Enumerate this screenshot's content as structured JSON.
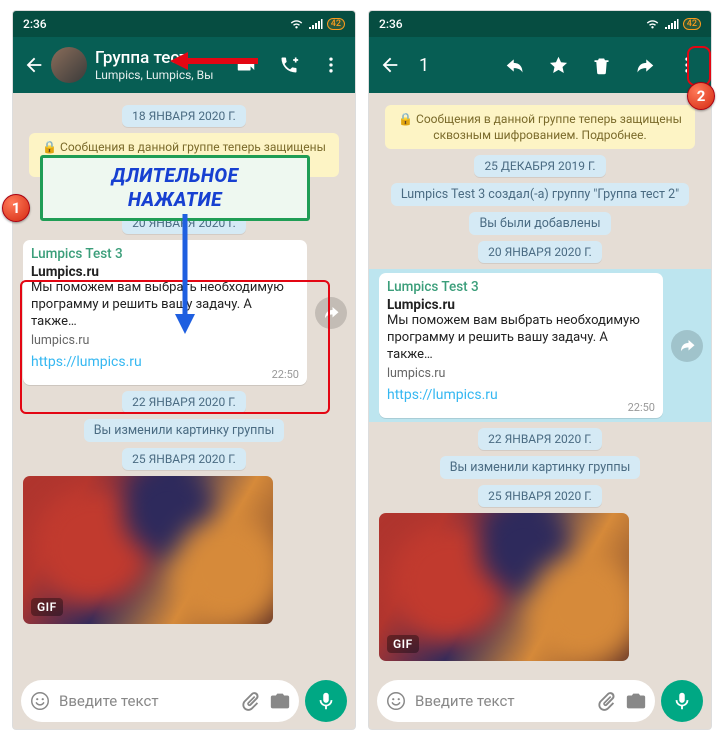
{
  "status": {
    "time": "2:36",
    "battery": "42"
  },
  "left_header": {
    "title": "Группа тест",
    "subtitle": "Lumpics, Lumpics, Вы"
  },
  "right_header": {
    "selected_count": "1"
  },
  "chips": {
    "encryption": "🔒 Сообщения в данной группе теперь защищены сквозным шифрованием. Подробнее.",
    "date_18jan": "18 ЯНВАРЯ 2020 Г.",
    "date_25dec": "25 ДЕКАБРЯ 2019 Г.",
    "date_20jan": "20 ЯНВАРЯ 2020 Г.",
    "date_22jan": "22 ЯНВАРЯ 2020 Г.",
    "date_25jan": "25 ЯНВАРЯ 2020 Г.",
    "sys_added": "Вы были добавлены",
    "sys_created": "Lumpics Test 3 создал(-а) группу \"Группа тест 2\"",
    "sys_picchange": "Вы изменили картинку группы"
  },
  "message": {
    "sender": "Lumpics Test 3",
    "preview_title": "Lumpics.ru",
    "preview_desc": "Мы поможем вам выбрать необходимую программу и решить вашу задачу. А также…",
    "preview_host": "lumpics.ru",
    "link": "https://lumpics.ru",
    "time": "22:50"
  },
  "input": {
    "placeholder": "Введите текст"
  },
  "gif": {
    "label": "GIF"
  },
  "annotations": {
    "callout_line1": "ДЛИТЕЛЬНОЕ",
    "callout_line2": "НАЖАТИЕ",
    "step1": "1",
    "step2": "2"
  }
}
